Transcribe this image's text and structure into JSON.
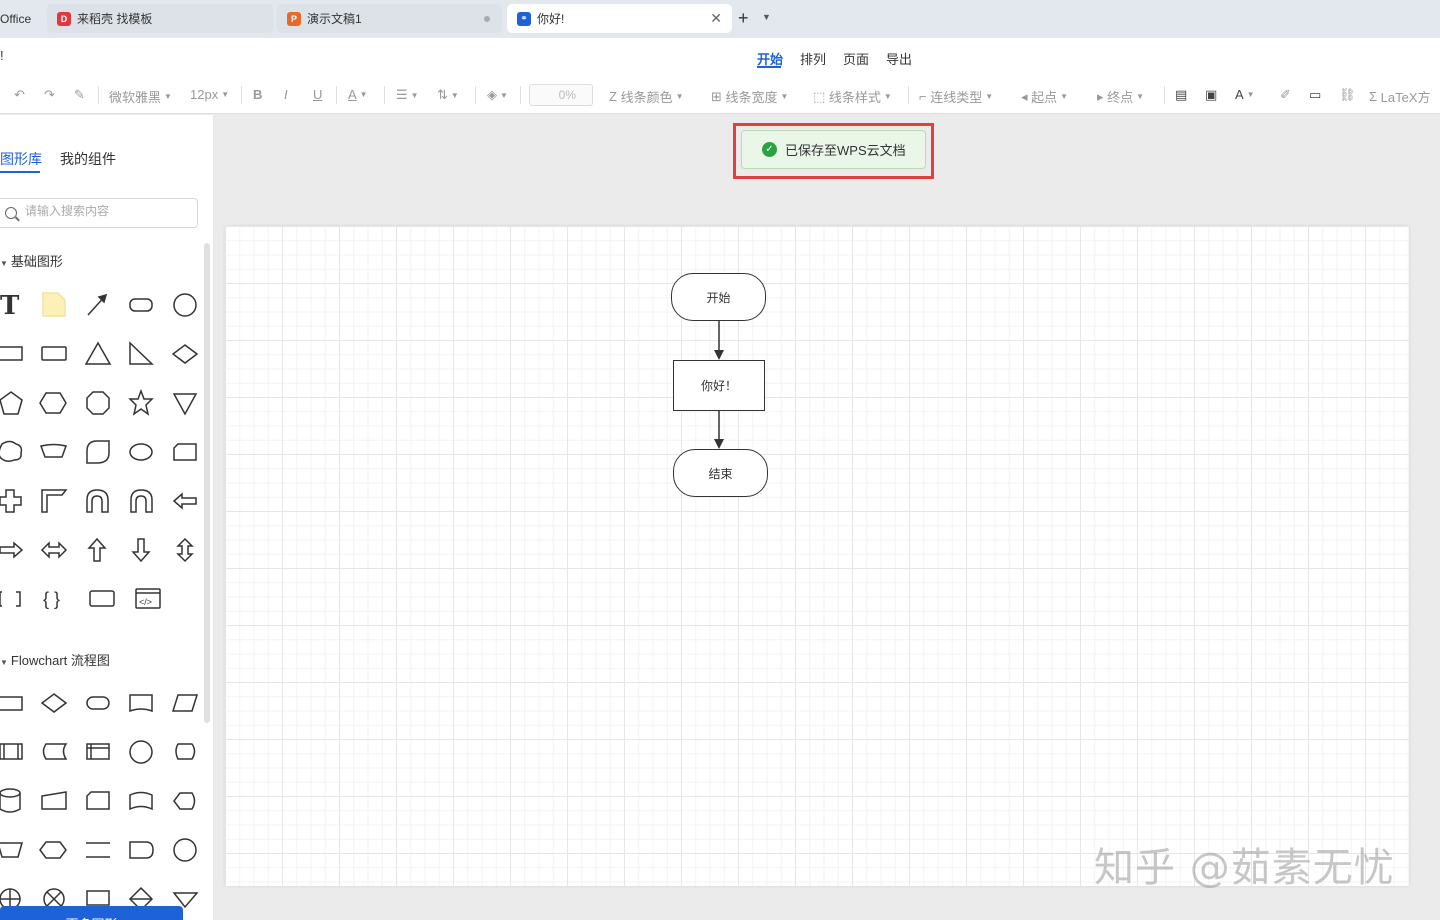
{
  "tabs": [
    {
      "label": "Office"
    },
    {
      "label": "来稻壳 找模板",
      "icon": "daoke-icon",
      "color": "#e0383e"
    },
    {
      "label": "演示文稿1",
      "icon": "presentation-icon",
      "color": "#e8692a"
    },
    {
      "label": "你好!",
      "icon": "flowchart-icon",
      "color": "#1e62d8"
    }
  ],
  "titlebar": {
    "mark": "!"
  },
  "menu": {
    "items": [
      "开始",
      "排列",
      "页面",
      "导出"
    ],
    "active": "开始"
  },
  "toolbar": {
    "font_family": "微软雅黑",
    "font_size": "12px",
    "bold": "B",
    "italic": "I",
    "underline": "U",
    "font_color": "A",
    "opacity": "0%",
    "line_color": "线条颜色",
    "line_width": "线条宽度",
    "line_style": "线条样式",
    "connector_type": "连线类型",
    "start_point": "起点",
    "end_point": "终点",
    "latex": "LaTeX方"
  },
  "sidebar": {
    "tabs": [
      "图形库",
      "我的组件"
    ],
    "search_placeholder": "请输入搜索内容",
    "sections": [
      {
        "title": "基础图形"
      },
      {
        "title": "Flowchart 流程图"
      }
    ],
    "more_button": "更多图形"
  },
  "toast": {
    "text": "已保存至WPS云文档",
    "color": "#2ea044"
  },
  "diagram": {
    "nodes": [
      {
        "label": "开始",
        "kind": "terminal"
      },
      {
        "label": "你好！",
        "kind": "process"
      },
      {
        "label": "结束",
        "kind": "terminal"
      }
    ]
  },
  "watermark": "知乎 @茹素无忧",
  "colors": {
    "accent": "#1e62d8",
    "highlight": "#e04040",
    "success": "#2ea044"
  }
}
